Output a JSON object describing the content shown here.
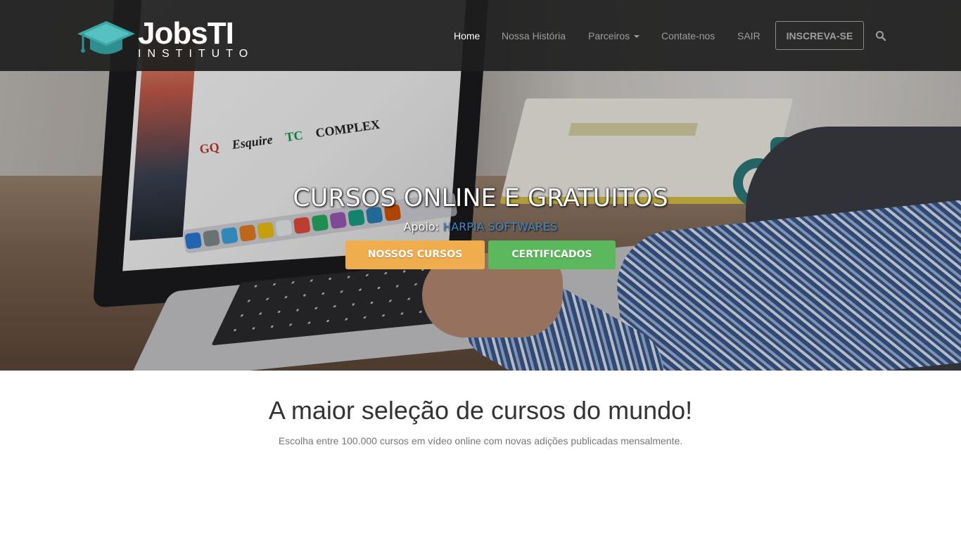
{
  "brand": {
    "name": "JobsTI",
    "tagline": "INSTITUTO"
  },
  "nav": {
    "home": "Home",
    "story": "Nossa História",
    "partners": "Parceiros",
    "contact": "Contate-nos",
    "logout": "SAIR",
    "subscribe": "INSCREVA-SE",
    "search_icon": "search-icon"
  },
  "hero": {
    "title": "CURSOS ONLINE E GRATUITOS",
    "support_label": "Apoio:",
    "support_link": "HARPIA SOFTWARES",
    "btn_courses": "NOSSOS CURSOS",
    "btn_certificates": "CERTIFICADOS",
    "screen_logos": [
      "GQ",
      "Esquire",
      "TC",
      "COMPLEX"
    ]
  },
  "section": {
    "title": "A maior seleção de cursos do mundo!",
    "subtitle": "Escolha entre 100.000 cursos em vídeo online com novas adições publicadas mensalmente."
  },
  "colors": {
    "navbar": "#1e1e1e",
    "orange_button": "#f0ad4e",
    "green_button": "#5cb85c",
    "link": "#428bca",
    "logo_teal": "#3aa6a6"
  }
}
